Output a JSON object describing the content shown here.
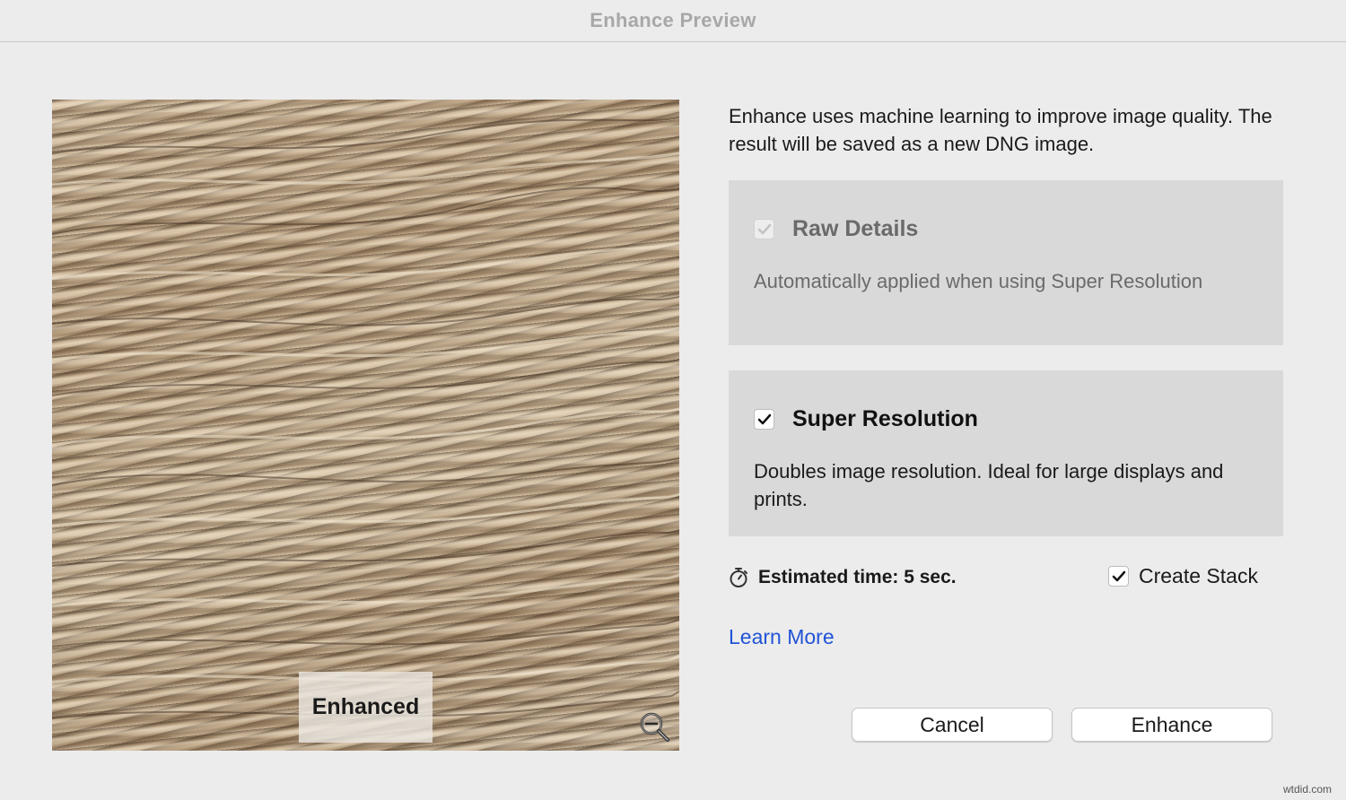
{
  "window": {
    "title": "Enhance Preview"
  },
  "preview": {
    "overlay_label": "Enhanced",
    "zoom_icon": "zoom-out-icon"
  },
  "intro_text": "Enhance uses machine learning to improve image quality. The result will be saved as a new DNG image.",
  "options": {
    "raw_details": {
      "label": "Raw Details",
      "description": "Automatically applied when using Super Resolution",
      "checked": true,
      "disabled": true
    },
    "super_resolution": {
      "label": "Super Resolution",
      "description": "Doubles image resolution. Ideal for large displays and prints.",
      "checked": true
    }
  },
  "estimate": {
    "icon": "stopwatch-icon",
    "text": "Estimated time: 5 sec."
  },
  "create_stack": {
    "label": "Create Stack",
    "checked": true
  },
  "learn_more": "Learn More",
  "buttons": {
    "cancel": "Cancel",
    "enhance": "Enhance"
  },
  "watermark": "wtdid.com",
  "colors": {
    "link": "#2154d6",
    "panel": "#d9d9d9",
    "background": "#ececec"
  }
}
